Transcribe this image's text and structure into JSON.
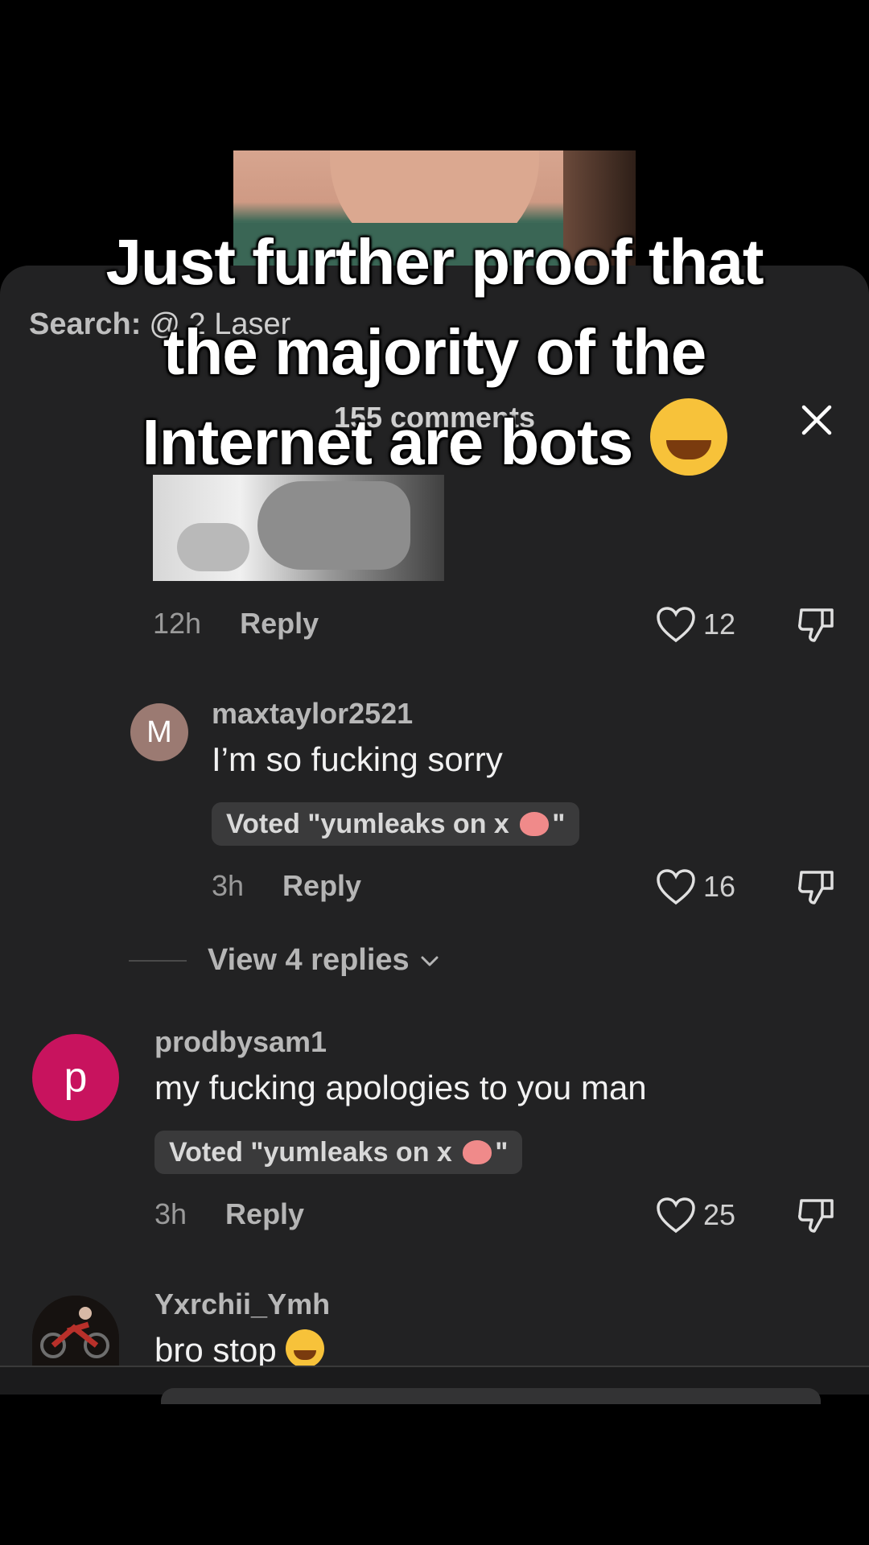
{
  "caption": {
    "line1": "Just further proof that",
    "line2": "the majority of the",
    "line3": "Internet are bots"
  },
  "search": {
    "label": "Search:",
    "term": "@ 2 Laser"
  },
  "comments_count": "155 comments",
  "top_comment": {
    "time": "12h",
    "reply": "Reply",
    "likes": "12"
  },
  "comments": [
    {
      "avatar_letter": "M",
      "username": "maxtaylor2521",
      "text": "I’m so fucking sorry",
      "vote_prefix": "Voted \"yumleaks on x ",
      "vote_suffix": "\"",
      "time": "3h",
      "reply": "Reply",
      "likes": "16"
    },
    {
      "avatar_letter": "p",
      "username": "prodbysam1",
      "text": "my fucking apologies to you man",
      "vote_prefix": "Voted \"yumleaks on x ",
      "vote_suffix": "\"",
      "time": "3h",
      "reply": "Reply",
      "likes": "25"
    },
    {
      "username": "Yxrchii_Ymh",
      "text": "bro stop "
    }
  ],
  "view_replies": "View 4 replies",
  "colors": {
    "sheet_bg": "#222223",
    "avatar_m": "#9b7a72",
    "avatar_p": "#c8135e"
  }
}
